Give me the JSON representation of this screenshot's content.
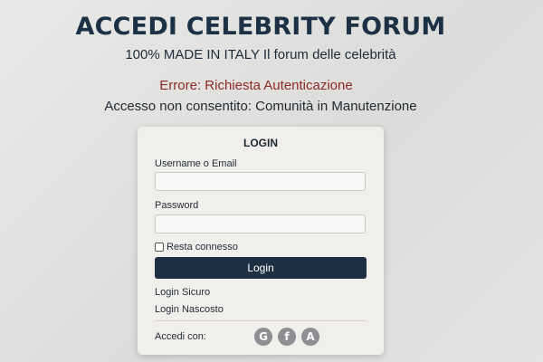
{
  "header": {
    "title": "ACCEDI CELEBRITY FORUM",
    "subtitle": "100% MADE IN ITALY Il forum delle celebrità",
    "error": "Errore: Richiesta Autenticazione",
    "notice": "Accesso non consentito: Comunità in Manutenzione"
  },
  "login_form": {
    "title": "LOGIN",
    "username_label": "Username o Email",
    "username_value": "",
    "password_label": "Password",
    "password_value": "",
    "remember_label": "Resta connesso",
    "remember_checked": false,
    "submit_label": "Login",
    "links": [
      "Login Sicuro",
      "Login Nascosto"
    ],
    "social_label": "Accedi con:",
    "social_icons": [
      {
        "name": "google-icon",
        "glyph": "G"
      },
      {
        "name": "facebook-icon",
        "glyph": "f"
      },
      {
        "name": "a-account-icon",
        "glyph": "A"
      }
    ]
  },
  "colors": {
    "title": "#1d3144",
    "error": "#8e2a24",
    "button": "#1e3043",
    "card": "#f1efec",
    "social_icon": "#8d8f93"
  }
}
